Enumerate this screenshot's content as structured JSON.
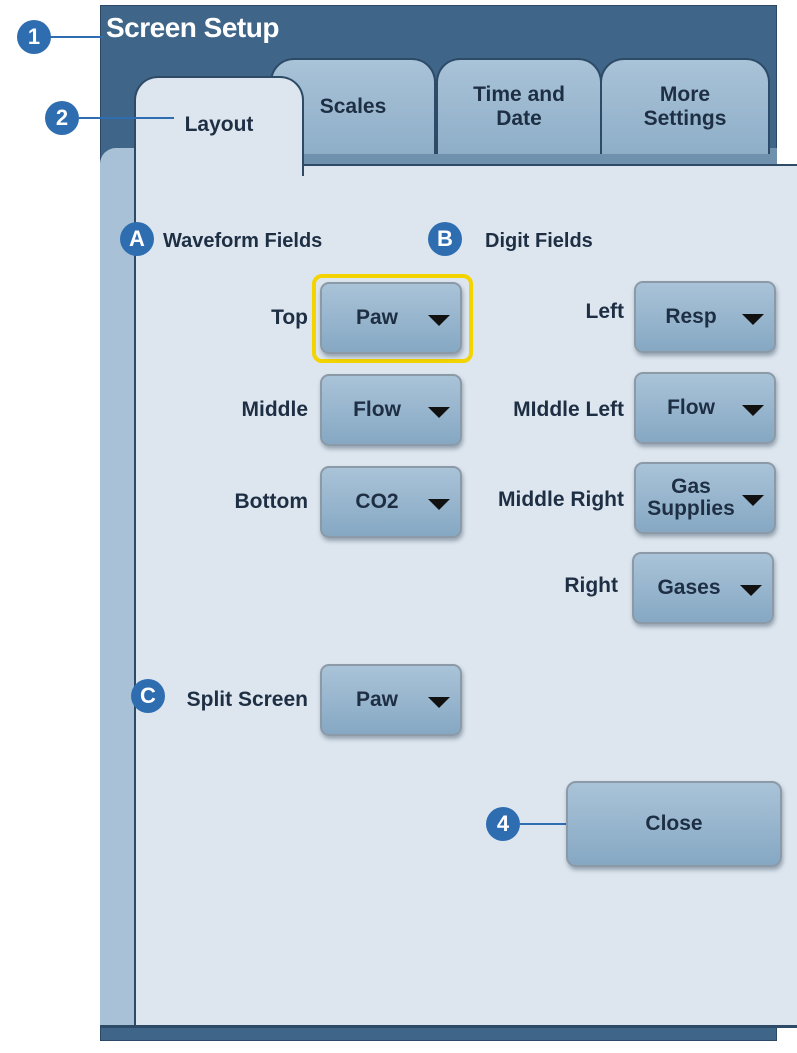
{
  "window": {
    "title": "Screen Setup"
  },
  "tabs": [
    {
      "label": "Layout",
      "active": true
    },
    {
      "label": "Scales",
      "active": false
    },
    {
      "label_lines": [
        "Time and",
        "Date"
      ],
      "active": false
    },
    {
      "label_lines": [
        "More",
        "Settings"
      ],
      "active": false
    }
  ],
  "callouts": {
    "c1": "1",
    "c2": "2",
    "cA": "A",
    "cB": "B",
    "cC": "C",
    "c4": "4"
  },
  "waveform": {
    "heading": "Waveform Fields",
    "fields": [
      {
        "label": "Top",
        "value": "Paw",
        "focused": true
      },
      {
        "label": "Middle",
        "value": "Flow"
      },
      {
        "label": "Bottom",
        "value": "CO2"
      }
    ]
  },
  "digit": {
    "heading": "Digit Fields",
    "fields": [
      {
        "label": "Left",
        "value": "Resp"
      },
      {
        "label": "MIddle Left",
        "value": "Flow"
      },
      {
        "label": "Middle Right",
        "value_lines": [
          "Gas",
          "Supplies"
        ]
      },
      {
        "label": "Right",
        "value": "Gases"
      }
    ]
  },
  "split": {
    "label": "Split Screen",
    "value": "Paw"
  },
  "close_label": "Close",
  "colors": {
    "title_bar": "#3f6589",
    "panel": "#dde6ef",
    "button": "#9fbcd3",
    "callout": "#2f6db1",
    "focus": "#f3d400"
  }
}
